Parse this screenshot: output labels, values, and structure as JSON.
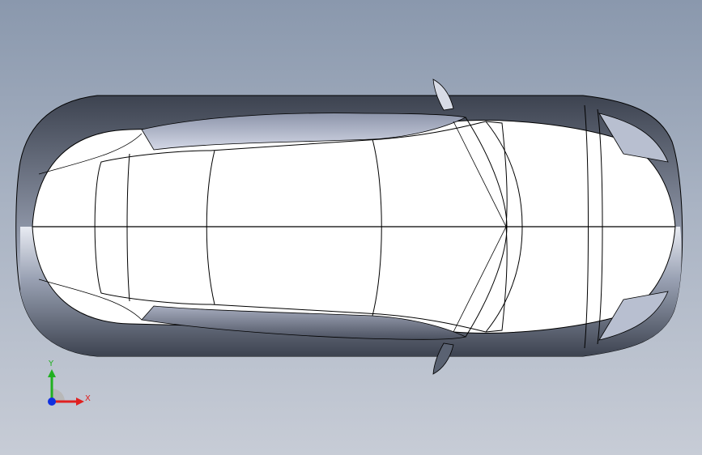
{
  "viewport": {
    "background_top": "#8a98ad",
    "background_bottom": "#c7ccd6"
  },
  "model": {
    "view": "top",
    "body_color": "#ffffff",
    "edge_color": "#000000",
    "shade_color": "#5a6272"
  },
  "triad": {
    "x_label": "X",
    "y_label": "Y",
    "x_color": "#e02020",
    "y_color": "#20b020",
    "z_color": "#1030e0"
  }
}
